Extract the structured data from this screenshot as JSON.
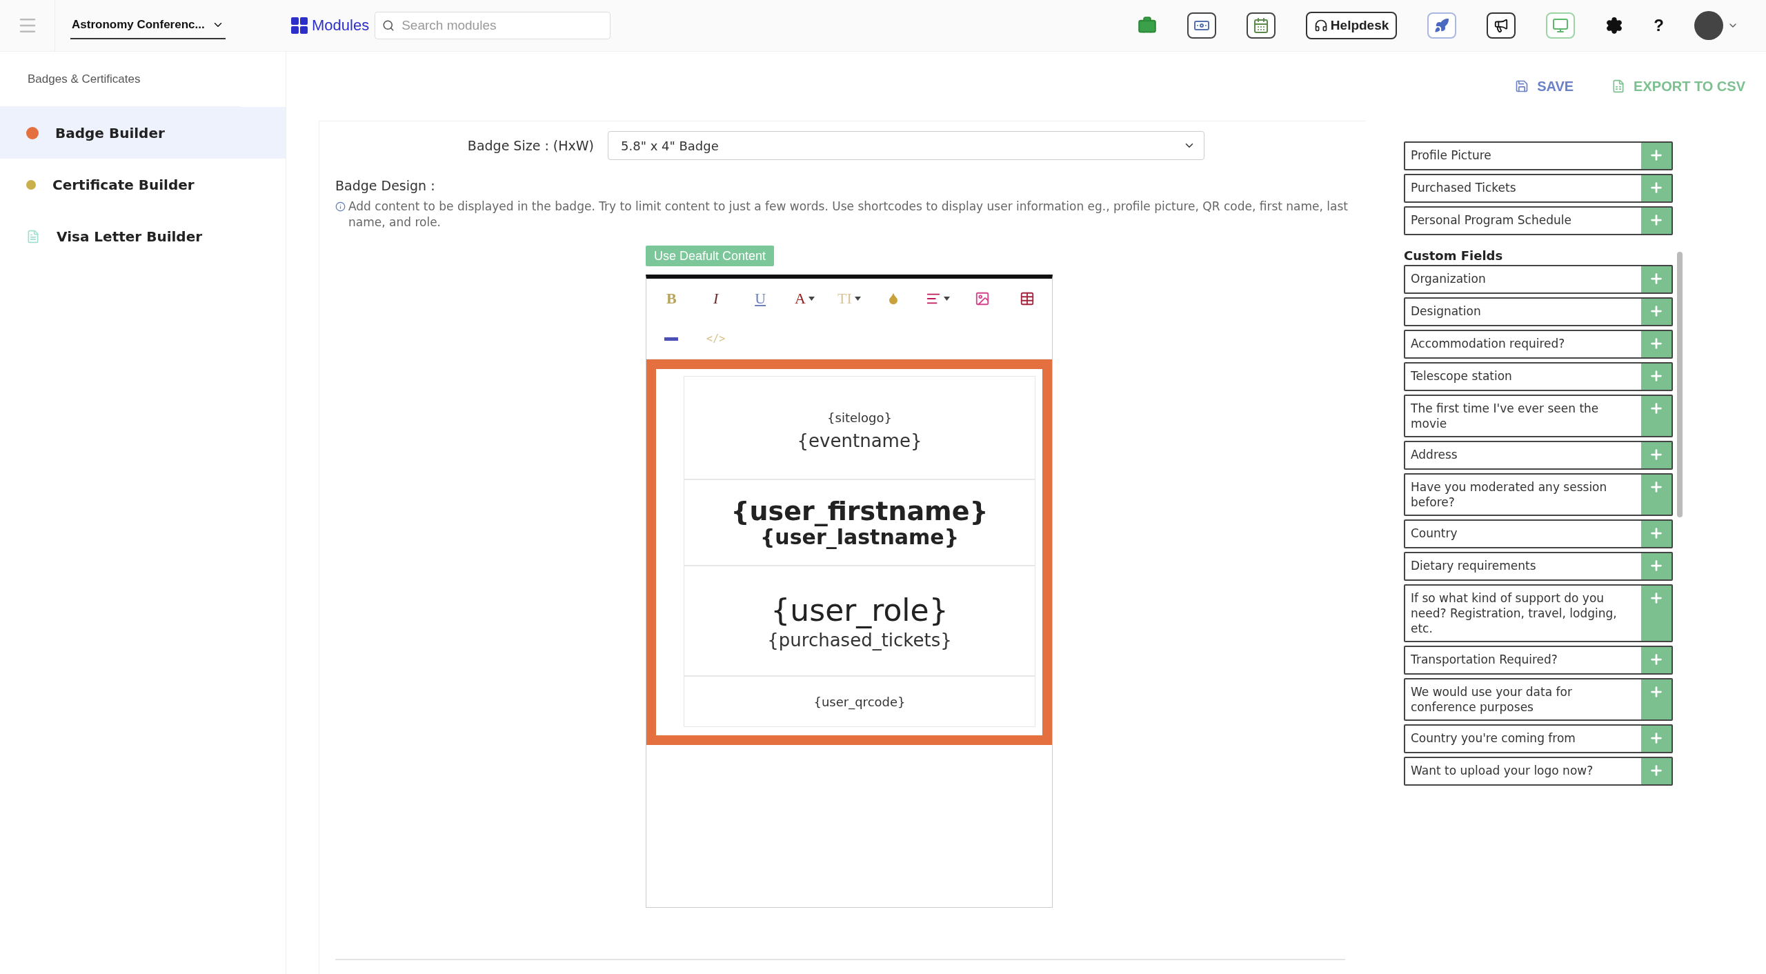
{
  "topbar": {
    "event_selector": "Astronomy Conferenc...",
    "modules_label": "Modules",
    "search": {
      "placeholder": "Search modules"
    },
    "helpdesk": "Helpdesk",
    "help": "?"
  },
  "sidebar": {
    "heading": "Badges & Certificates",
    "items": [
      {
        "label": "Badge Builder",
        "kind": "badge",
        "selected": true
      },
      {
        "label": "Certificate Builder",
        "kind": "certificate",
        "selected": false
      },
      {
        "label": "Visa Letter Builder",
        "kind": "letter",
        "selected": false
      }
    ]
  },
  "actions": [
    {
      "label": "SAVE",
      "kind": "save"
    },
    {
      "label": "EXPORT TO CSV",
      "kind": "export"
    }
  ],
  "badge_size": {
    "label": "Badge Size : (HxW)",
    "value": "5.8\" x 4\" Badge"
  },
  "badge_design": {
    "label": "Badge Design :",
    "hint": "Add content to be displayed in the badge. Try to limit content to just a few words. Use shortcodes to display user information eg., profile picture, QR code, first name, last name, and role."
  },
  "default_button": "Use Deafult Content",
  "toolbar": [
    {
      "kind": "bold",
      "text": "B"
    },
    {
      "kind": "italic",
      "text": "I"
    },
    {
      "kind": "underline",
      "text": "U"
    },
    {
      "kind": "color",
      "text": "A"
    },
    {
      "kind": "size",
      "text": "TI"
    },
    {
      "kind": "fill"
    },
    {
      "kind": "align"
    },
    {
      "kind": "image"
    },
    {
      "kind": "table"
    },
    {
      "kind": "rule"
    },
    {
      "kind": "code",
      "text": "</>"
    }
  ],
  "badge": {
    "sections": [
      {
        "lines": [
          {
            "text": "{sitelogo}",
            "kind": "small"
          },
          {
            "text": "{eventname}",
            "kind": "medium"
          }
        ]
      },
      {
        "lines": [
          {
            "text": "{user_firstname}",
            "kind": "title"
          },
          {
            "text": "{user_lastname}",
            "kind": "subtitle"
          }
        ]
      },
      {
        "lines": [
          {
            "text": "{user_role}",
            "kind": "large"
          },
          {
            "text": "{purchased_tickets}",
            "kind": "medium"
          }
        ]
      },
      {
        "lines": [
          {
            "text": "{user_qrcode}",
            "kind": "small"
          }
        ]
      }
    ]
  },
  "fields": {
    "standard": [
      "Profile Picture",
      "Purchased Tickets",
      "Personal Program Schedule"
    ],
    "custom_heading": "Custom Fields",
    "custom": [
      "Organization",
      "Designation",
      "Accommodation required?",
      "Telescope station",
      "The first time I've ever seen the movie",
      "Address",
      "Have you moderated any session before?",
      "Country",
      "Dietary requirements",
      "If so what kind of support do you need? Registration, travel, lodging, etc.",
      "Transportation Required?",
      "We would use your data for conference purposes",
      "Country you're coming from",
      "Want to upload your logo now?"
    ]
  }
}
